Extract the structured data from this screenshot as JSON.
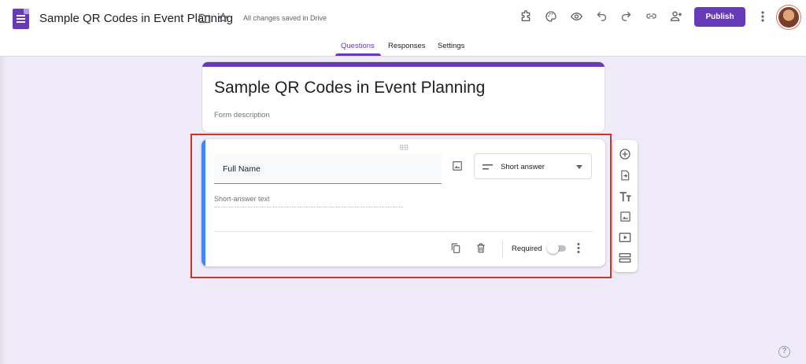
{
  "header": {
    "doc_title": "Sample QR Codes in Event Planning",
    "save_status": "All changes saved in Drive",
    "publish_label": "Publish",
    "toolbar_icons": [
      "addons-icon",
      "palette-icon",
      "preview-icon",
      "undo-icon",
      "redo-icon",
      "link-icon",
      "add-collaborator-icon",
      "more-vert-icon"
    ]
  },
  "tabs": [
    {
      "label": "Questions",
      "active": true
    },
    {
      "label": "Responses",
      "active": false
    },
    {
      "label": "Settings",
      "active": false
    }
  ],
  "form": {
    "title": "Sample QR Codes in Event Planning",
    "description_placeholder": "Form description"
  },
  "question": {
    "title": "Full Name",
    "type_label": "Short answer",
    "answer_placeholder": "Short-answer text",
    "required_label": "Required",
    "required": false
  },
  "side_toolbar": [
    "add-question-icon",
    "import-questions-icon",
    "add-title-icon",
    "add-image-icon",
    "add-video-icon",
    "add-section-icon"
  ],
  "colors": {
    "accent": "#673ab7",
    "background": "#f0ebf8",
    "question_bar": "#4285f4",
    "highlight": "#d93025"
  }
}
